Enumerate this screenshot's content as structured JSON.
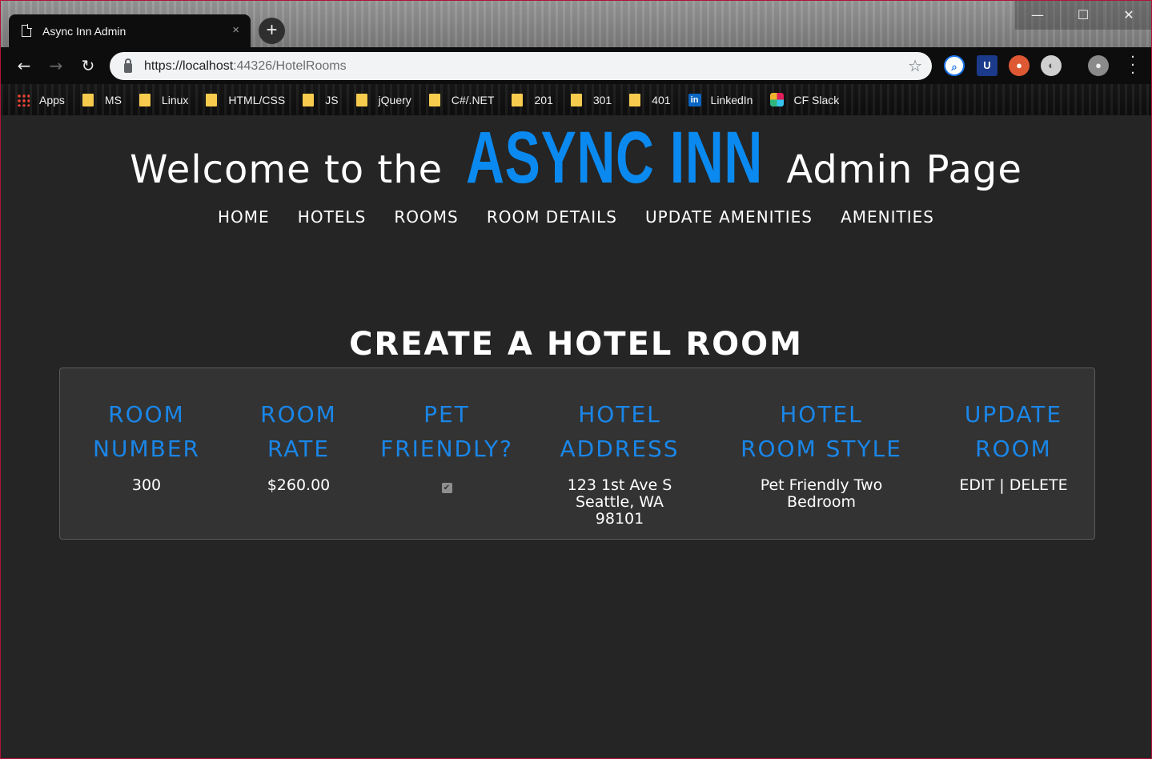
{
  "browser": {
    "tab_title": "Async Inn Admin",
    "tab_close": "×",
    "new_tab": "+",
    "window_controls": {
      "minimize": "—",
      "maximize": "☐",
      "close": "✕"
    },
    "url_host": "https://localhost",
    "url_rest": ":44326/HotelRooms",
    "bookmarks": [
      "Apps",
      "MS",
      "Linux",
      "HTML/CSS",
      "JS",
      "jQuery",
      "C#/.NET",
      "201",
      "301",
      "401",
      "LinkedIn",
      "CF Slack"
    ]
  },
  "page": {
    "welcome_prefix": "Welcome to the",
    "brand": "ASYNC INN",
    "welcome_suffix": "Admin Page",
    "nav": [
      "HOME",
      "HOTELS",
      "ROOMS",
      "ROOM DETAILS",
      "UPDATE AMENITIES",
      "AMENITIES"
    ],
    "section_title": "CREATE A HOTEL ROOM",
    "table": {
      "headers": [
        [
          "ROOM",
          "NUMBER"
        ],
        [
          "ROOM",
          "RATE"
        ],
        [
          "PET",
          "FRIENDLY?"
        ],
        [
          "HOTEL",
          "ADDRESS"
        ],
        [
          "HOTEL",
          "ROOM STYLE"
        ],
        [
          "UPDATE",
          "ROOM"
        ]
      ],
      "row": {
        "room_number": "300",
        "room_rate": "$260.00",
        "pet_friendly": true,
        "address": [
          "123 1st Ave S",
          "Seattle, WA",
          "98101"
        ],
        "room_style": [
          "Pet Friendly Two",
          "Bedroom"
        ],
        "edit": "EDIT",
        "separator": " | ",
        "delete": "DELETE"
      }
    }
  },
  "colors": {
    "background": "#252525",
    "panel": "#333333",
    "brand": "#0a8af0",
    "header": "#1a86e8"
  }
}
